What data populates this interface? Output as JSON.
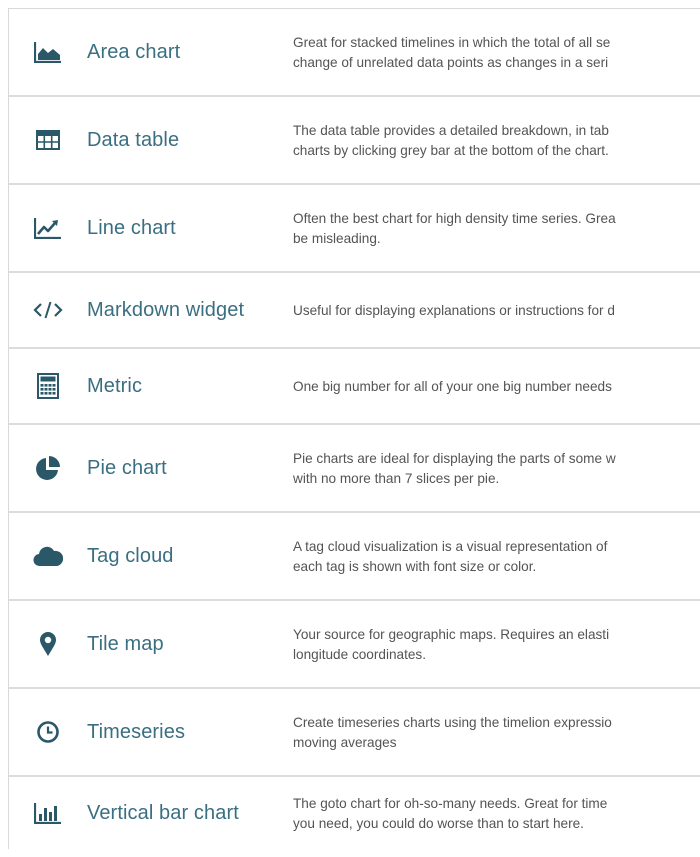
{
  "visualizations": [
    {
      "name": "Area chart",
      "icon": "area-chart-icon",
      "description_lines": [
        "Great for stacked timelines in which the total of all se",
        "change of unrelated data points as changes in a seri"
      ]
    },
    {
      "name": "Data table",
      "icon": "table-icon",
      "description_lines": [
        "The data table provides a detailed breakdown, in tab",
        "charts by clicking grey bar at the bottom of the chart."
      ]
    },
    {
      "name": "Line chart",
      "icon": "line-chart-icon",
      "description_lines": [
        "Often the best chart for high density time series. Grea",
        "be misleading."
      ]
    },
    {
      "name": "Markdown widget",
      "icon": "code-icon",
      "description_lines": [
        "Useful for displaying explanations or instructions for d"
      ]
    },
    {
      "name": "Metric",
      "icon": "calculator-icon",
      "description_lines": [
        "One big number for all of your one big number needs"
      ]
    },
    {
      "name": "Pie chart",
      "icon": "pie-chart-icon",
      "description_lines": [
        "Pie charts are ideal for displaying the parts of some w",
        "with no more than 7 slices per pie."
      ]
    },
    {
      "name": "Tag cloud",
      "icon": "cloud-icon",
      "description_lines": [
        "A tag cloud visualization is a visual representation of",
        "each tag is shown with font size or color."
      ]
    },
    {
      "name": "Tile map",
      "icon": "map-marker-icon",
      "description_lines": [
        "Your source for geographic maps. Requires an elasti",
        "longitude coordinates."
      ]
    },
    {
      "name": "Timeseries",
      "icon": "clock-icon",
      "description_lines": [
        "Create timeseries charts using the timelion expressio",
        "moving averages"
      ]
    },
    {
      "name": "Vertical bar chart",
      "icon": "bar-chart-icon",
      "description_lines": [
        "The goto chart for oh-so-many needs. Great for time",
        "you need, you could do worse than to start here."
      ]
    }
  ],
  "colors": {
    "icon": "#2b5869",
    "label": "#3a6f82",
    "description": "#545454",
    "divider": "#dcdcdc"
  }
}
